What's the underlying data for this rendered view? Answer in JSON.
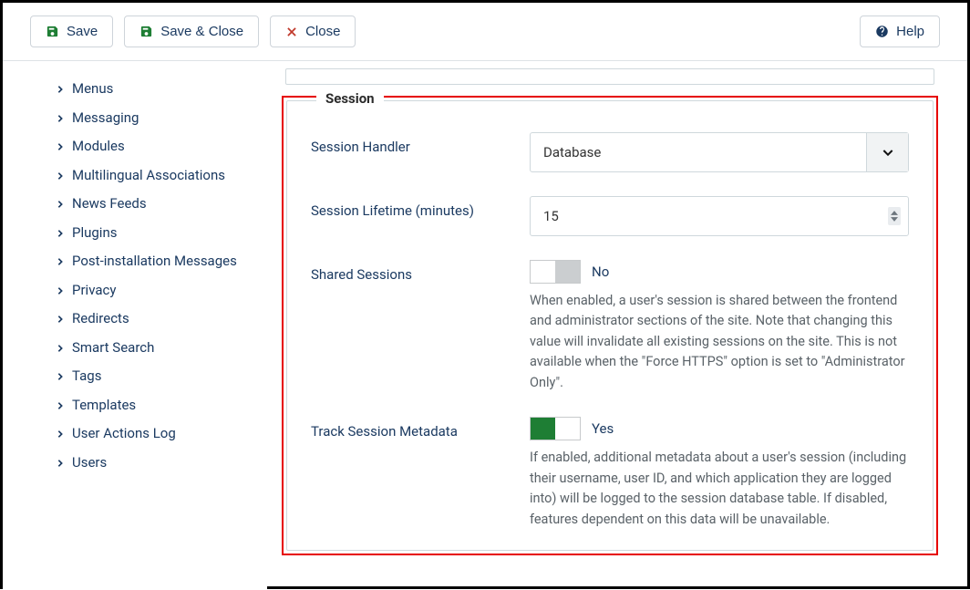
{
  "toolbar": {
    "save": "Save",
    "save_close": "Save & Close",
    "close": "Close",
    "help": "Help"
  },
  "sidebar": {
    "items": [
      "Menus",
      "Messaging",
      "Modules",
      "Multilingual Associations",
      "News Feeds",
      "Plugins",
      "Post-installation Messages",
      "Privacy",
      "Redirects",
      "Smart Search",
      "Tags",
      "Templates",
      "User Actions Log",
      "Users"
    ]
  },
  "session": {
    "legend": "Session",
    "handler_label": "Session Handler",
    "handler_value": "Database",
    "lifetime_label": "Session Lifetime (minutes)",
    "lifetime_value": "15",
    "shared_label": "Shared Sessions",
    "shared_value": "No",
    "shared_desc": "When enabled, a user's session is shared between the frontend and administrator sections of the site. Note that changing this value will invalidate all existing sessions on the site. This is not available when the \"Force HTTPS\" option is set to \"Administrator Only\".",
    "track_label": "Track Session Metadata",
    "track_value": "Yes",
    "track_desc": "If enabled, additional metadata about a user's session (including their username, user ID, and which application they are logged into) will be logged to the session database table. If disabled, features dependent on this data will be unavailable."
  }
}
